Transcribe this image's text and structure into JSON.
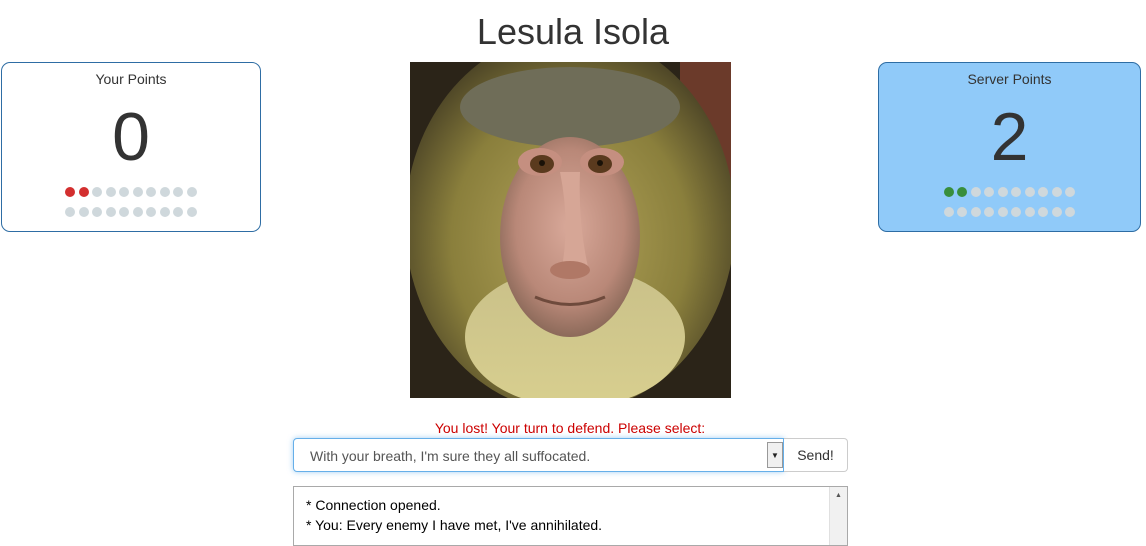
{
  "title": "Lesula Isola",
  "player": {
    "label": "Your Points",
    "score": "0",
    "dots_lost": 2,
    "dots_total": 20
  },
  "server": {
    "label": "Server Points",
    "score": "2",
    "dots_won": 2,
    "dots_total": 20
  },
  "photo": {
    "icon": "monkey-photo"
  },
  "status": "You lost! Your turn to defend. Please select:",
  "select": {
    "value": "With your breath, I'm sure they all suffocated."
  },
  "send_label": "Send!",
  "log": {
    "lines": [
      "* Connection opened.",
      "* You: Every enemy I have met, I've annihilated."
    ]
  },
  "colors": {
    "lost": "#d32f2f",
    "won": "#388e3c",
    "idle": "#cfd8dc",
    "server_panel": "#90caf9",
    "status": "#cc0000"
  }
}
